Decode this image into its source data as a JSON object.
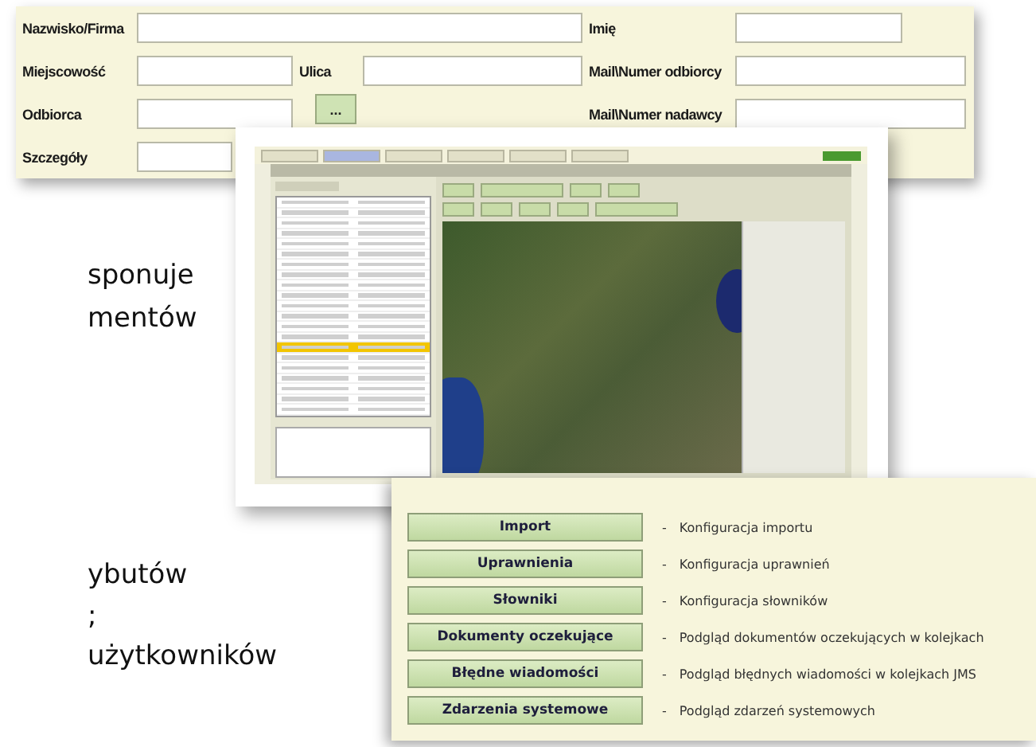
{
  "form": {
    "rows": [
      [
        {
          "kind": "label",
          "text": "Nazwisko/Firma"
        },
        {
          "kind": "field"
        },
        {
          "kind": "empty"
        },
        {
          "kind": "empty"
        },
        {
          "kind": "label",
          "text": "Imię"
        },
        {
          "kind": "field"
        }
      ],
      [
        {
          "kind": "label",
          "text": "Miejscowość"
        },
        {
          "kind": "field"
        },
        {
          "kind": "label",
          "text": "Ulica"
        },
        {
          "kind": "field"
        },
        {
          "kind": "label",
          "text": "Mail\\Numer odbiorcy"
        },
        {
          "kind": "field"
        }
      ],
      [
        {
          "kind": "label",
          "text": "Odbiorca"
        },
        {
          "kind": "field"
        },
        {
          "kind": "button",
          "text": "..."
        },
        {
          "kind": "empty"
        },
        {
          "kind": "label",
          "text": "Mail\\Numer nadawcy"
        },
        {
          "kind": "field"
        }
      ],
      [
        {
          "kind": "label",
          "text": "Szczegóły"
        },
        {
          "kind": "field"
        }
      ]
    ]
  },
  "side_text": [
    "sponuje",
    "mentów",
    "ybutów",
    ";",
    "użytkowników"
  ],
  "admin_menu": [
    {
      "button": "Import",
      "bullet": "-",
      "description": "Konfiguracja importu"
    },
    {
      "button": "Uprawnienia",
      "bullet": "-",
      "description": "Konfiguracja uprawnień"
    },
    {
      "button": "Słowniki",
      "bullet": "-",
      "description": "Konfiguracja słowników"
    },
    {
      "button": "Dokumenty oczekujące",
      "bullet": "-",
      "description": "Podgląd dokumentów oczekujących w kolejkach"
    },
    {
      "button": "Błędne wiadomości",
      "bullet": "-",
      "description": "Podgląd błędnych wiadomości w kolejkach JMS"
    },
    {
      "button": "Zdarzenia systemowe",
      "bullet": "-",
      "description": "Podgląd zdarzeń systemowych"
    }
  ]
}
